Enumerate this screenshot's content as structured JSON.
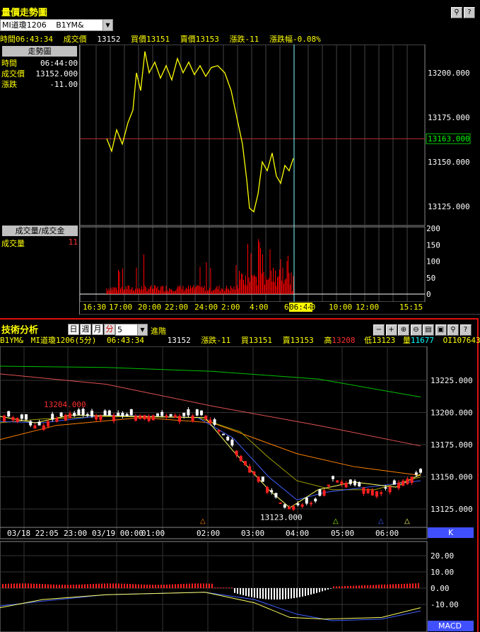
{
  "top": {
    "title": "量價走勢圖",
    "symbol_select": "MI道瓊1206",
    "symbol_code": "B1YM&",
    "quote": {
      "time": "時間06:43:34",
      "trade_label": "成交價",
      "trade": "13152",
      "bid": "買價13151",
      "ask": "賣價13153",
      "change": "漲跌-11",
      "change_pct": "漲跌幅-0.08%"
    },
    "side_panel_title": "走勢圖",
    "info": [
      {
        "label": "時間",
        "value": "06:44:00"
      },
      {
        "label": "成交價",
        "value": "13152.000"
      },
      {
        "label": "漲跌",
        "value": "-11.00"
      }
    ],
    "volume_panel_title": "成交量/成交金",
    "volume_label": "成交量",
    "volume_value": "11",
    "price_axis": [
      "13200.000",
      "13175.000",
      "13163.000",
      "13150.000",
      "13125.000"
    ],
    "volume_axis": [
      "200",
      "150",
      "100",
      "50",
      "0"
    ],
    "time_axis": [
      "16:30",
      "17:00",
      "20:00",
      "22:00",
      "24:00",
      "2:00",
      "4:00",
      "6:",
      "06:44",
      "00",
      "10:00",
      "12:00",
      "15:15"
    ]
  },
  "bottom": {
    "title": "技術分析",
    "period_tabs": [
      "日",
      "週",
      "月",
      "分"
    ],
    "period_active": "分",
    "interval": "5",
    "advanced": "進階",
    "toolbar_icons": [
      "minus-icon",
      "plus-icon",
      "zoom-in-icon",
      "zoom-out-icon",
      "chart-icon",
      "save-icon",
      "search-icon",
      "help-icon"
    ],
    "info": {
      "code": "B1YM&",
      "name": "MI道瓊1206(5分)",
      "time": "06:43:34",
      "price": "13152",
      "change": "漲跌-11",
      "bid": "買13151",
      "ask": "賣13153",
      "high_label": "高",
      "high": "13208",
      "low": "低13123",
      "vol_label": "量",
      "vol": "11677",
      "oi": "OI107643"
    },
    "k_axis": [
      "13225.000",
      "13200.000",
      "13175.000",
      "13150.000",
      "13125.000"
    ],
    "k_high_label": "13204.000",
    "k_low_label": "13123.000",
    "time_axis": [
      "03/18 22:05",
      "23:00",
      "03/19 00:00",
      "01:00",
      "02:00",
      "03:00",
      "04:00",
      "05:00",
      "06:00"
    ],
    "k_tag": "K",
    "macd_axis": [
      "20.00",
      "10.00",
      "0.00",
      "-10.00"
    ],
    "macd_tag": "MACD"
  }
}
